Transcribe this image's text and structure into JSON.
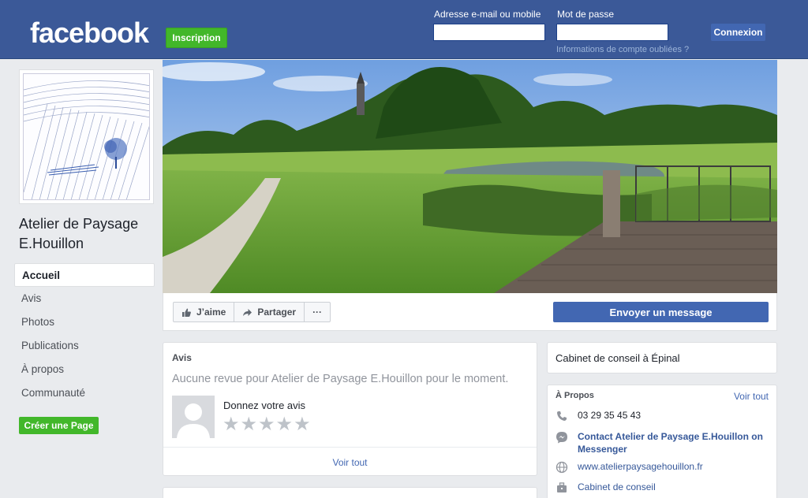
{
  "header": {
    "logo": "facebook",
    "signup_label": "Inscription",
    "email_label": "Adresse e-mail ou mobile",
    "email_value": "",
    "password_label": "Mot de passe",
    "password_value": "",
    "login_label": "Connexion",
    "forgot_label": "Informations de compte oubliées ?"
  },
  "sidebar": {
    "page_name": "Atelier de Paysage E.Houillon",
    "items": [
      {
        "label": "Accueil",
        "active": true
      },
      {
        "label": "Avis"
      },
      {
        "label": "Photos"
      },
      {
        "label": "Publications"
      },
      {
        "label": "À propos"
      },
      {
        "label": "Communauté"
      }
    ],
    "create_page_label": "Créer une Page"
  },
  "actions": {
    "like_label": "J’aime",
    "share_label": "Partager",
    "more_label": "···",
    "message_label": "Envoyer un message"
  },
  "reviews": {
    "title": "Avis",
    "empty_text": "Aucune revue pour Atelier de Paysage E.Houillon pour le moment.",
    "prompt": "Donnez votre avis",
    "see_all": "Voir tout"
  },
  "category": {
    "text": "Cabinet de conseil à Épinal"
  },
  "about": {
    "title": "À Propos",
    "see_all": "Voir tout",
    "phone": "03 29 35 45 43",
    "messenger": "Contact Atelier de Paysage E.Houillon on Messenger",
    "website": "www.atelierpaysagehouillon.fr",
    "category_link": "Cabinet de conseil"
  },
  "colors": {
    "brand_blue": "#3b5998",
    "button_blue": "#4267b2",
    "green": "#42b72a",
    "page_bg": "#e9ebee"
  }
}
